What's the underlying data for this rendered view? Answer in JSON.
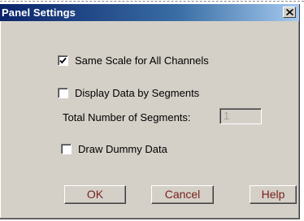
{
  "dialog": {
    "title": "Panel Settings",
    "close_glyph": "×"
  },
  "options": {
    "same_scale": {
      "label": "Same Scale for All Channels",
      "checked": true
    },
    "display_segments": {
      "label": "Display Data by Segments",
      "checked": false
    },
    "total_segments_label": "Total Number of Segments:",
    "total_segments_value": "1",
    "draw_dummy": {
      "label": "Draw Dummy Data",
      "checked": false
    }
  },
  "buttons": {
    "ok": "OK",
    "cancel": "Cancel",
    "help": "Help"
  },
  "colors": {
    "title_bar_start": "#0a246a",
    "title_bar_end": "#a6caf0",
    "button_text": "#7a1f1a",
    "face": "#d4d0c8"
  }
}
